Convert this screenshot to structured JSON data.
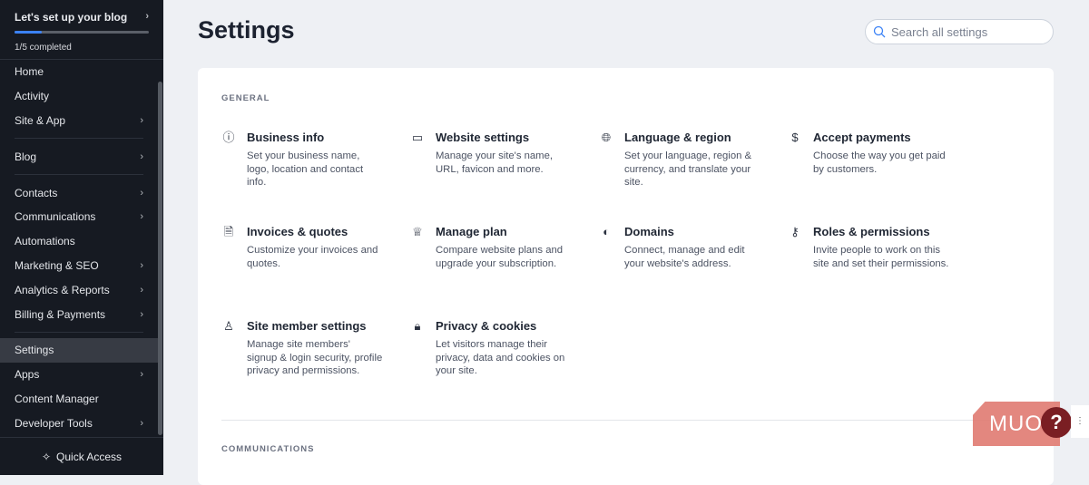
{
  "setup": {
    "title": "Let's set up your blog",
    "progress_text": "1/5 completed",
    "progress": 0.2
  },
  "nav": [
    {
      "label": "Home",
      "chev": false
    },
    {
      "label": "Activity",
      "chev": false
    },
    {
      "label": "Site & App",
      "chev": true
    },
    {
      "sep": true
    },
    {
      "label": "Blog",
      "chev": true
    },
    {
      "sep": true
    },
    {
      "label": "Contacts",
      "chev": true
    },
    {
      "label": "Communications",
      "chev": true
    },
    {
      "label": "Automations",
      "chev": false
    },
    {
      "label": "Marketing & SEO",
      "chev": true
    },
    {
      "label": "Analytics & Reports",
      "chev": true
    },
    {
      "label": "Billing & Payments",
      "chev": true
    },
    {
      "sep": true
    },
    {
      "label": "Settings",
      "chev": false,
      "active": true
    },
    {
      "label": "Apps",
      "chev": true
    },
    {
      "label": "Content Manager",
      "chev": false
    },
    {
      "label": "Developer Tools",
      "chev": true
    }
  ],
  "quick_access": "Quick Access",
  "page_title": "Settings",
  "search_placeholder": "Search all settings",
  "sections": {
    "general": "GENERAL",
    "communications": "COMMUNICATIONS"
  },
  "tiles": [
    {
      "icon": "info-icon",
      "glyph": "ⓘ",
      "title": "Business info",
      "desc": "Set your business name, logo, location and contact info."
    },
    {
      "icon": "browser-window-icon",
      "glyph": "▭",
      "title": "Website settings",
      "desc": "Manage your site's name, URL, favicon and more."
    },
    {
      "icon": "globe-icon",
      "glyph": "🌐︎",
      "title": "Language & region",
      "desc": "Set your language, region & currency, and translate your site."
    },
    {
      "icon": "dollar-icon",
      "glyph": "$",
      "title": "Accept payments",
      "desc": "Choose the way you get paid by customers."
    },
    {
      "icon": "invoice-icon",
      "glyph": "🗎",
      "title": "Invoices & quotes",
      "desc": "Customize your invoices and quotes."
    },
    {
      "icon": "crown-icon",
      "glyph": "♕",
      "title": "Manage plan",
      "desc": "Compare website plans and upgrade your subscription."
    },
    {
      "icon": "domain-globe-icon",
      "glyph": "◐",
      "title": "Domains",
      "desc": "Connect, manage and edit your website's address."
    },
    {
      "icon": "user-key-icon",
      "glyph": "⚷",
      "title": "Roles & permissions",
      "desc": "Invite people to work on this site and set their permissions."
    },
    {
      "icon": "member-icon",
      "glyph": "♙",
      "title": "Site member settings",
      "desc": "Manage site members' signup & login security, profile privacy and permissions."
    },
    {
      "icon": "lock-icon",
      "glyph": "🔒︎",
      "title": "Privacy & cookies",
      "desc": "Let visitors manage their privacy, data and cookies on your site."
    }
  ],
  "watermark": "MUO",
  "help": "?"
}
